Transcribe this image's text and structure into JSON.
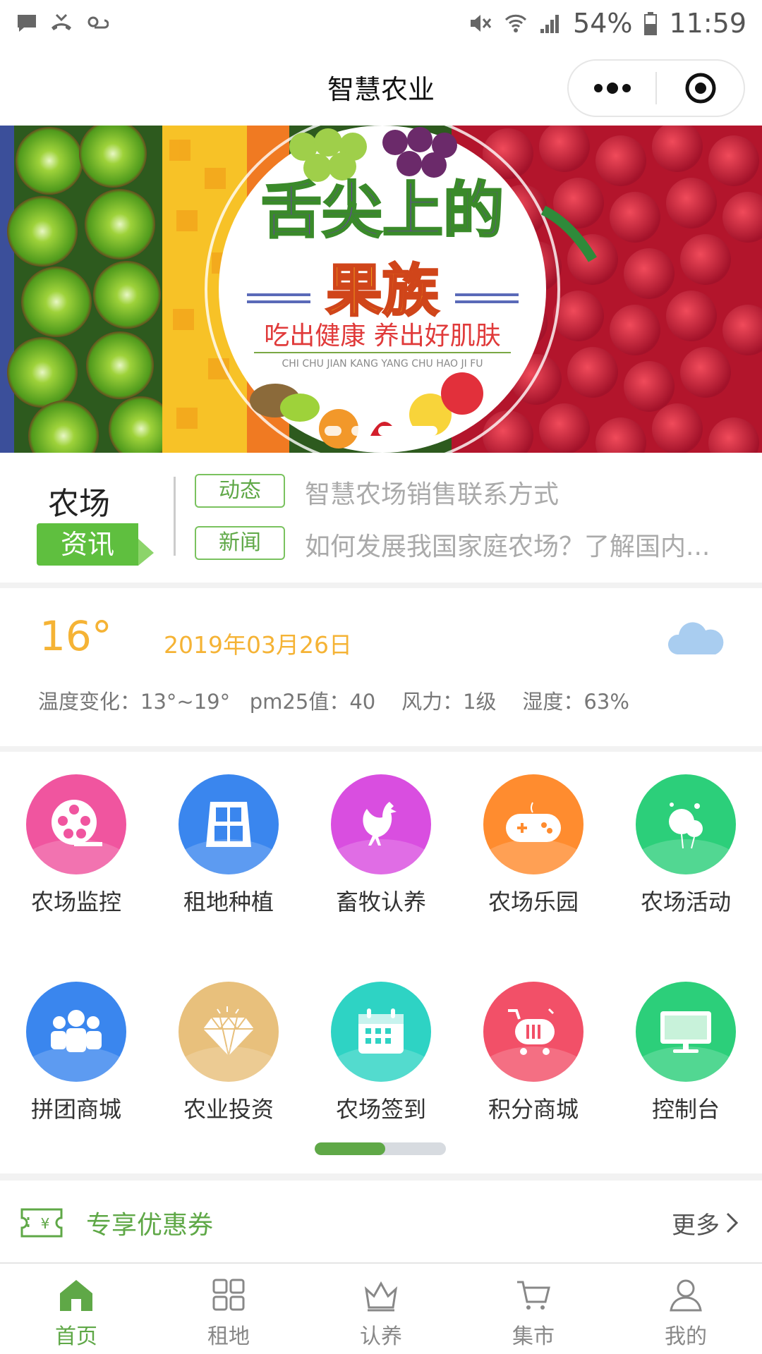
{
  "status": {
    "battery": "54%",
    "time": "11:59"
  },
  "nav": {
    "title": "智慧农业"
  },
  "banner": {
    "headline_line1": "舌尖上的",
    "headline_line2": "果族",
    "slogan": "吃出健康 养出好肌肤",
    "pinyin": "CHI CHU JIAN KANG YANG CHU HAO JI FU",
    "slide_count": 3,
    "active_slide": 3
  },
  "news": {
    "farm_label": "农场",
    "info_label": "资讯",
    "items": [
      {
        "tag": "动态",
        "text": "智慧农场销售联系方式"
      },
      {
        "tag": "新闻",
        "text": "如何发展我国家庭农场？了解国内..."
      }
    ]
  },
  "weather": {
    "temperature": "16°",
    "date": "2019年03月26日",
    "detail": "温度变化：13°~19°   pm25值：40    风力：1级    湿度：63%"
  },
  "grid": {
    "items": [
      {
        "label": "农场监控",
        "icon": "film-reel-icon",
        "color": "#f0559f"
      },
      {
        "label": "租地种植",
        "icon": "window-grid-icon",
        "color": "#3a86ee"
      },
      {
        "label": "畜牧认养",
        "icon": "rooster-icon",
        "color": "#d94ee0"
      },
      {
        "label": "农场乐园",
        "icon": "gamepad-icon",
        "color": "#ff8c2f"
      },
      {
        "label": "农场活动",
        "icon": "balloons-icon",
        "color": "#2ccf7a"
      },
      {
        "label": "拼团商城",
        "icon": "group-people-icon",
        "color": "#3a86ee"
      },
      {
        "label": "农业投资",
        "icon": "diamond-icon",
        "color": "#e8c07c"
      },
      {
        "label": "农场签到",
        "icon": "calendar-icon",
        "color": "#2ed3c4"
      },
      {
        "label": "积分商城",
        "icon": "shopping-cart-icon",
        "color": "#f25068"
      },
      {
        "label": "控制台",
        "icon": "monitor-icon",
        "color": "#2ccf7a"
      }
    ],
    "page_indicator": {
      "pages": 2,
      "active": 1
    }
  },
  "coupon": {
    "label": "专享优惠券",
    "more": "更多"
  },
  "tabbar": {
    "items": [
      {
        "label": "首页",
        "icon": "home-icon",
        "active": true
      },
      {
        "label": "租地",
        "icon": "four-squares-icon",
        "active": false
      },
      {
        "label": "认养",
        "icon": "crown-icon",
        "active": false
      },
      {
        "label": "集市",
        "icon": "cart-icon",
        "active": false
      },
      {
        "label": "我的",
        "icon": "user-icon",
        "active": false
      }
    ]
  },
  "colors": {
    "brand_green": "#5fa847",
    "weather_orange": "#f5b335"
  }
}
